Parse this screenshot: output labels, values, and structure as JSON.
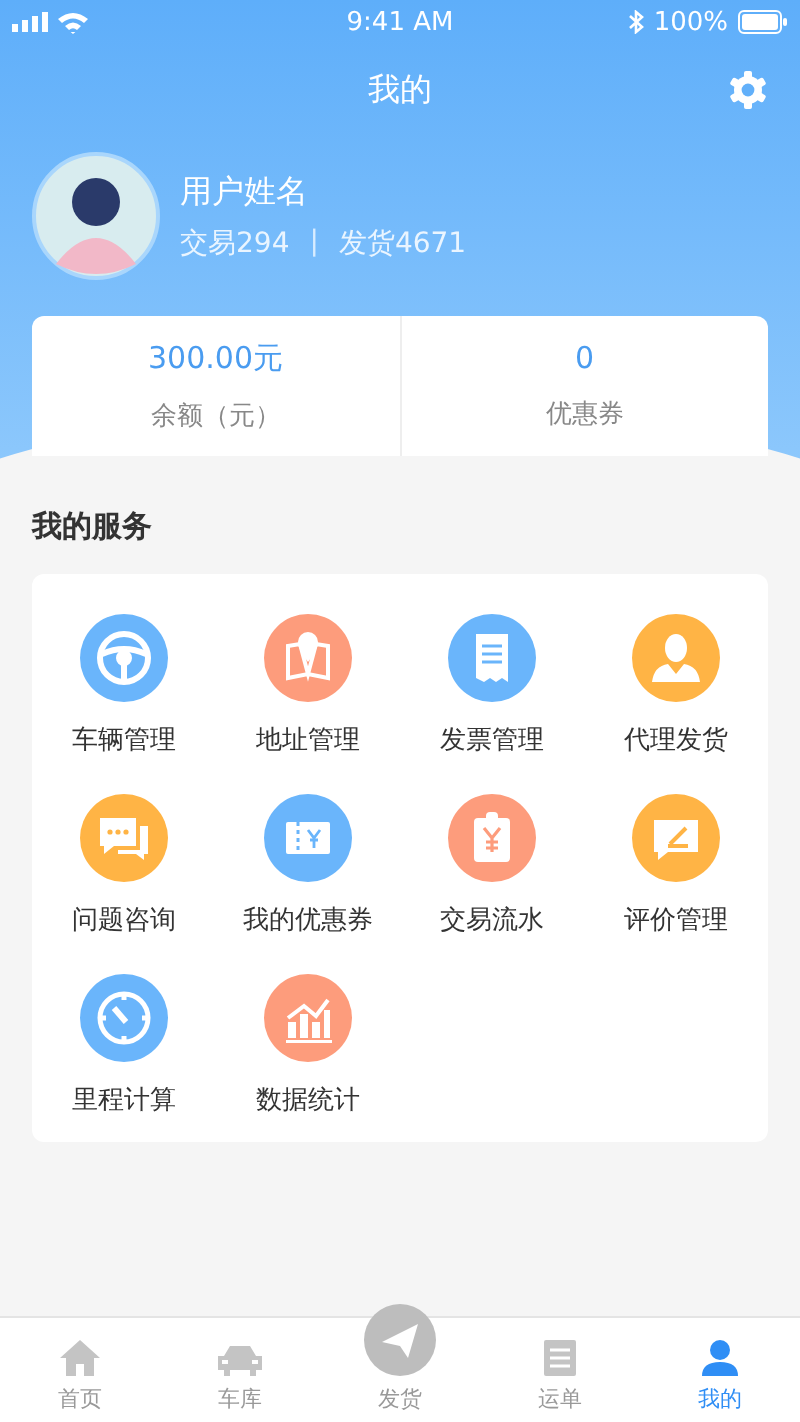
{
  "status_bar": {
    "time": "9:41 AM",
    "battery": "100%"
  },
  "nav": {
    "title": "我的"
  },
  "profile": {
    "name": "用户姓名",
    "trades": "交易294",
    "separator": "|",
    "shipments": "发货4671"
  },
  "stats": [
    {
      "value": "300.00元",
      "label": "余额（元）"
    },
    {
      "value": "0",
      "label": "优惠券"
    }
  ],
  "services": {
    "title": "我的服务",
    "items": [
      {
        "label": "车辆管理",
        "color": "#6ab5fb"
      },
      {
        "label": "地址管理",
        "color": "#fd9c7c"
      },
      {
        "label": "发票管理",
        "color": "#6ab5fb"
      },
      {
        "label": "代理发货",
        "color": "#ffb445"
      },
      {
        "label": "问题咨询",
        "color": "#ffb445"
      },
      {
        "label": "我的优惠券",
        "color": "#6ab5fb"
      },
      {
        "label": "交易流水",
        "color": "#fd9c7c"
      },
      {
        "label": "评价管理",
        "color": "#ffb445"
      },
      {
        "label": "里程计算",
        "color": "#6ab5fb"
      },
      {
        "label": "数据统计",
        "color": "#fd9c7c"
      }
    ]
  },
  "tabs": [
    {
      "label": "首页",
      "selected": false
    },
    {
      "label": "车库",
      "selected": false
    },
    {
      "label": "发货",
      "selected": false
    },
    {
      "label": "运单",
      "selected": false
    },
    {
      "label": "我的",
      "selected": true
    }
  ]
}
